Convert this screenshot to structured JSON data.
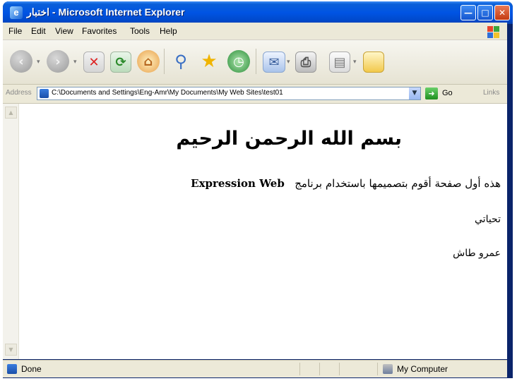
{
  "window": {
    "title": "اختبار - Microsoft Internet Explorer",
    "minimize_glyph": "—",
    "maximize_glyph": "□",
    "close_glyph": "✕"
  },
  "menu": {
    "items": [
      "File",
      "Edit",
      "View",
      "Favorites",
      "Tools",
      "Help"
    ]
  },
  "toolbar": {
    "buttons": [
      "back-icon",
      "forward-icon",
      "stop-icon",
      "refresh-icon",
      "home-icon",
      "search-icon",
      "favorites-icon",
      "history-icon",
      "mail-icon",
      "print-icon",
      "edit-icon",
      "discuss-icon"
    ]
  },
  "address": {
    "label": "Address",
    "value": "C:\\Documents and Settings\\Eng-Amr\\My Documents\\My Web Sites\\test01",
    "go_label": "Go",
    "links_label": "Links"
  },
  "document": {
    "heading": "بسم الله الرحمن الرحيم",
    "line1_arabic": "هذه أول صفحة أقوم بتصميمها باستخدام برنامج",
    "line1_latin": "Expression Web",
    "line2": "تحياتي",
    "line3": "عمرو طاش"
  },
  "status": {
    "text": "Done",
    "zone": "My Computer"
  }
}
